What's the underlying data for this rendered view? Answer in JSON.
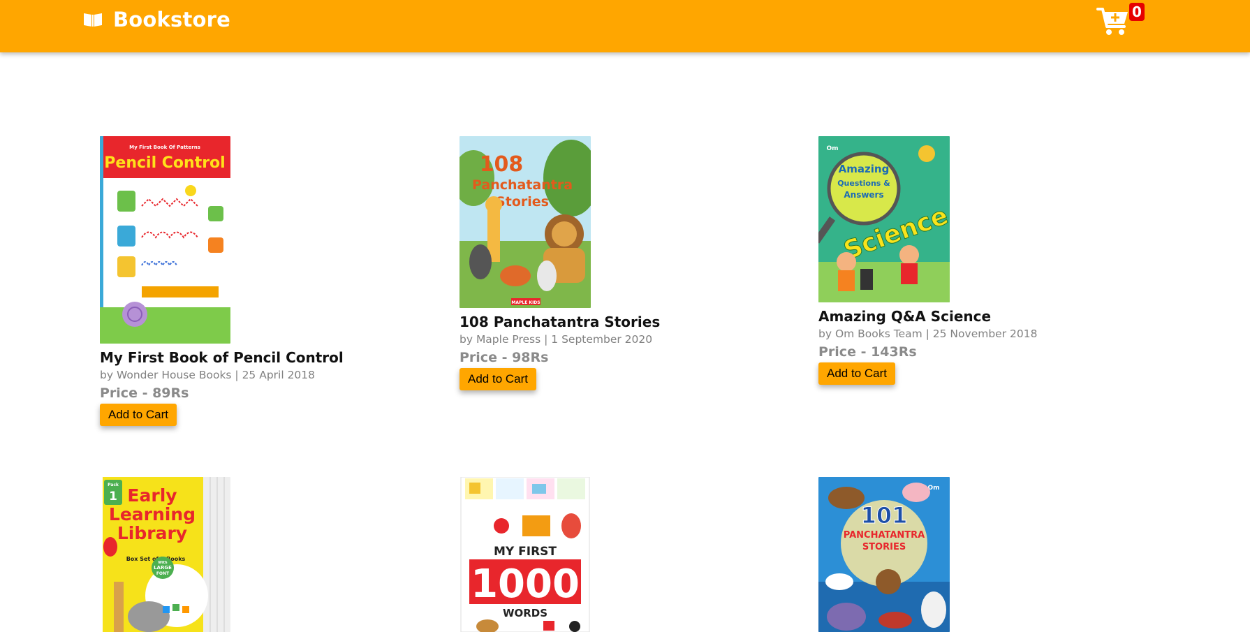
{
  "navbar": {
    "brand": "Bookstore",
    "cart_count": "0",
    "bg_color": "#ffa600"
  },
  "books": [
    {
      "title": "My First Book of Pencil Control",
      "meta": "by Wonder House Books | 25 April 2018",
      "price": "Price - 89Rs",
      "button": "Add to Cart",
      "cover_text": [
        "My First Book Of Patterns",
        "Pencil Control"
      ]
    },
    {
      "title": "108 Panchatantra Stories",
      "meta": "by Maple Press | 1 September 2020",
      "price": "Price - 98Rs",
      "button": "Add to Cart",
      "cover_text": [
        "108",
        "Panchatantra",
        "Stories",
        "MAPLE KIDS"
      ]
    },
    {
      "title": "Amazing Q&A Science",
      "meta": "by Om Books Team | 25 November 2018",
      "price": "Price - 143Rs",
      "button": "Add to Cart",
      "cover_text": [
        "Om",
        "Amazing",
        "Questions &",
        "Answers",
        "Science"
      ]
    },
    {
      "cover_text": [
        "Pack",
        "1",
        "Early",
        "Learning",
        "Library",
        "Box Set of 5 Books",
        "With",
        "LARGE",
        "FONT"
      ]
    },
    {
      "cover_text": [
        "MY FIRST",
        "1000",
        "WORDS"
      ]
    },
    {
      "cover_text": [
        "Om",
        "101",
        "PANCHATANTRA",
        "STORIES"
      ]
    }
  ]
}
